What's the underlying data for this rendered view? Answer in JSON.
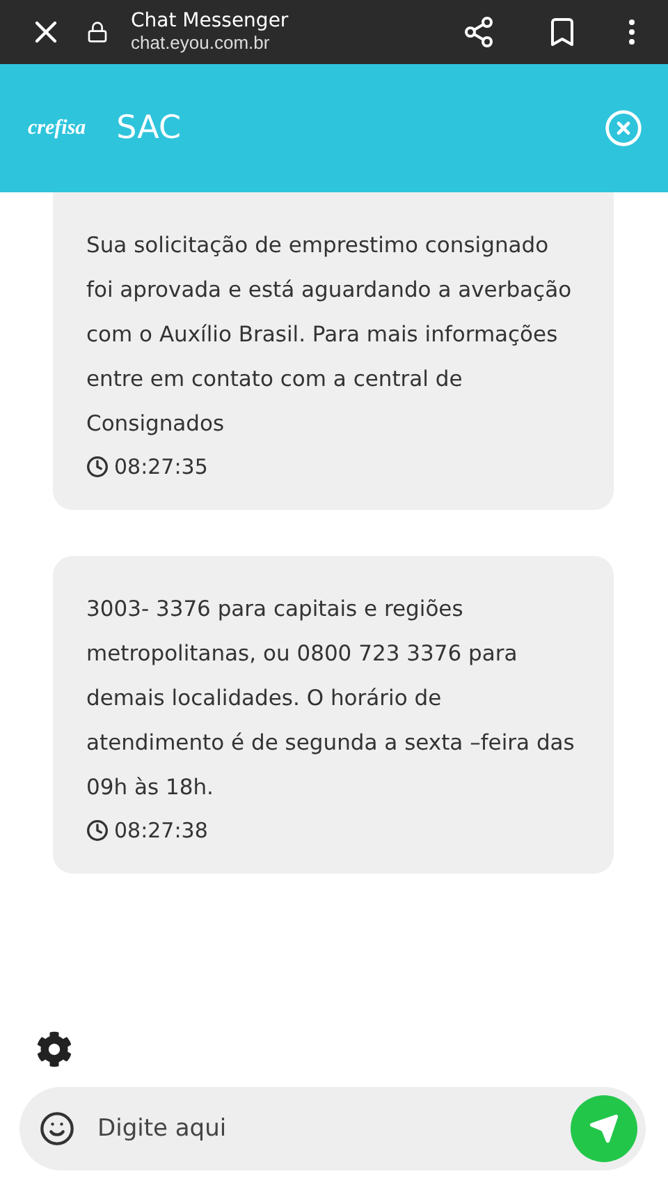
{
  "browser_bar": {
    "title": "Chat Messenger",
    "url": "chat.eyou.com.br"
  },
  "header": {
    "logo": "crefisa",
    "title": "SAC"
  },
  "messages": [
    {
      "text": "Sua solicitação de emprestimo consignado foi aprovada e está aguardando a averbação com o Auxílio Brasil. Para mais informações entre em contato com a central de Consignados",
      "time": "08:27:35"
    },
    {
      "text": "3003- 3376 para capitais e regiões metropolitanas, ou 0800 723 3376 para demais localidades. O horário de atendimento é de segunda a sexta –feira das 09h às 18h.",
      "time": "08:27:38"
    }
  ],
  "composer": {
    "placeholder": "Digite aqui"
  }
}
